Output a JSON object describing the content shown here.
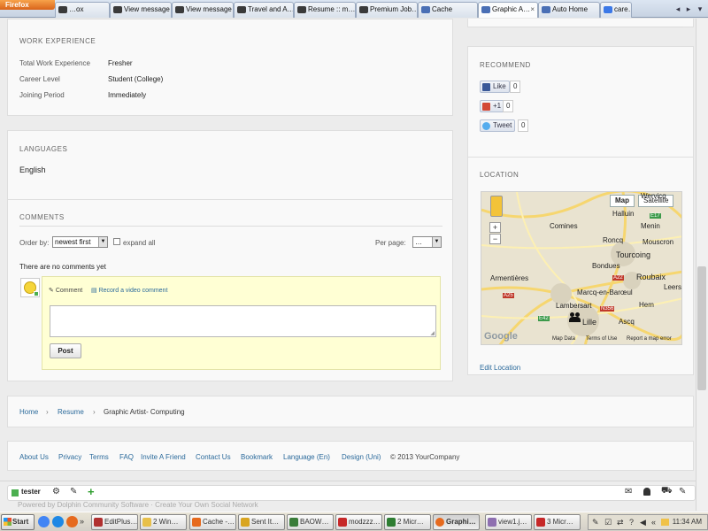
{
  "browser": {
    "menu_button": "Firefox",
    "tabs": [
      {
        "label": "…ox"
      },
      {
        "label": "View message"
      },
      {
        "label": "View message"
      },
      {
        "label": "Travel and A…"
      },
      {
        "label": "Resume :: m…"
      },
      {
        "label": "Premium Job…"
      },
      {
        "label": "Cache"
      },
      {
        "label": "Graphic A…"
      },
      {
        "label": "Auto Home"
      },
      {
        "label": "care…"
      }
    ],
    "tab_close": "×",
    "nav_left": "◂",
    "nav_right": "▸",
    "nav_down": "▾"
  },
  "work_experience": {
    "title": "WORK EXPERIENCE",
    "rows": [
      {
        "label": "Total Work Experience",
        "value": "Fresher"
      },
      {
        "label": "Career Level",
        "value": "Student (College)"
      },
      {
        "label": "Joining Period",
        "value": "Immediately"
      }
    ]
  },
  "languages": {
    "title": "LANGUAGES",
    "value": "English"
  },
  "comments": {
    "title": "COMMENTS",
    "order_by_label": "Order by:",
    "order_by_value": "newest first",
    "expand_all_label": "expand all",
    "per_page_label": "Per page:",
    "per_page_value": "…",
    "empty_text": "There are no comments yet",
    "comment_tab": "Comment",
    "video_tab": "Record a video comment",
    "post_button": "Post"
  },
  "recommend": {
    "title": "RECOMMEND",
    "like": {
      "label": "Like",
      "count": "0"
    },
    "plusone": {
      "label": "+1",
      "count": "0"
    },
    "tweet": {
      "label": "Tweet",
      "count": "0"
    }
  },
  "location": {
    "title": "LOCATION",
    "map_button": "Map",
    "satellite_button": "Satellite",
    "places": [
      "Wervicq",
      "Halluin",
      "Comines",
      "Menin",
      "Roncq",
      "Mouscron",
      "Tourcoing",
      "Bondues",
      "Roubaix",
      "Armentières",
      "Marcq-en-Barœul",
      "Leers",
      "Lambersart",
      "Hem",
      "Lille",
      "Ascq"
    ],
    "roads": [
      "E17",
      "A22",
      "A25",
      "N356",
      "E42"
    ],
    "google_logo": "Google",
    "map_data": "Map Data",
    "terms": "Terms of Use",
    "report": "Report a map error",
    "edit_link": "Edit Location"
  },
  "breadcrumb": {
    "home": "Home",
    "resume": "Resume",
    "current": "Graphic Artist- Computing",
    "sep": "›"
  },
  "footer": {
    "links": [
      "About Us",
      "Privacy",
      "Terms",
      "FAQ",
      "Invite A Friend",
      "Contact Us",
      "Bookmark",
      "Language (En)",
      "Design (Uni)"
    ],
    "copyright": "© 2013 YourCompany"
  },
  "userbar": {
    "username": "tester",
    "powered": "Powered by Dolphin Community Software · Create Your Own Social Network"
  },
  "taskbar": {
    "start": "Start",
    "buttons": [
      "EditPlus…",
      "2 Win…",
      "Cache -…",
      "Sent It…",
      "BAOW…",
      "modzzz…",
      "2 Micr…",
      "Graphi…",
      "view1.j…",
      "3 Micr…"
    ],
    "clock": "11:34 AM",
    "tray_arrow": "«"
  },
  "colors": {
    "link": "#2b6a9b",
    "comment_bg": "#ffffd4",
    "online_dot": "#4caf50"
  }
}
